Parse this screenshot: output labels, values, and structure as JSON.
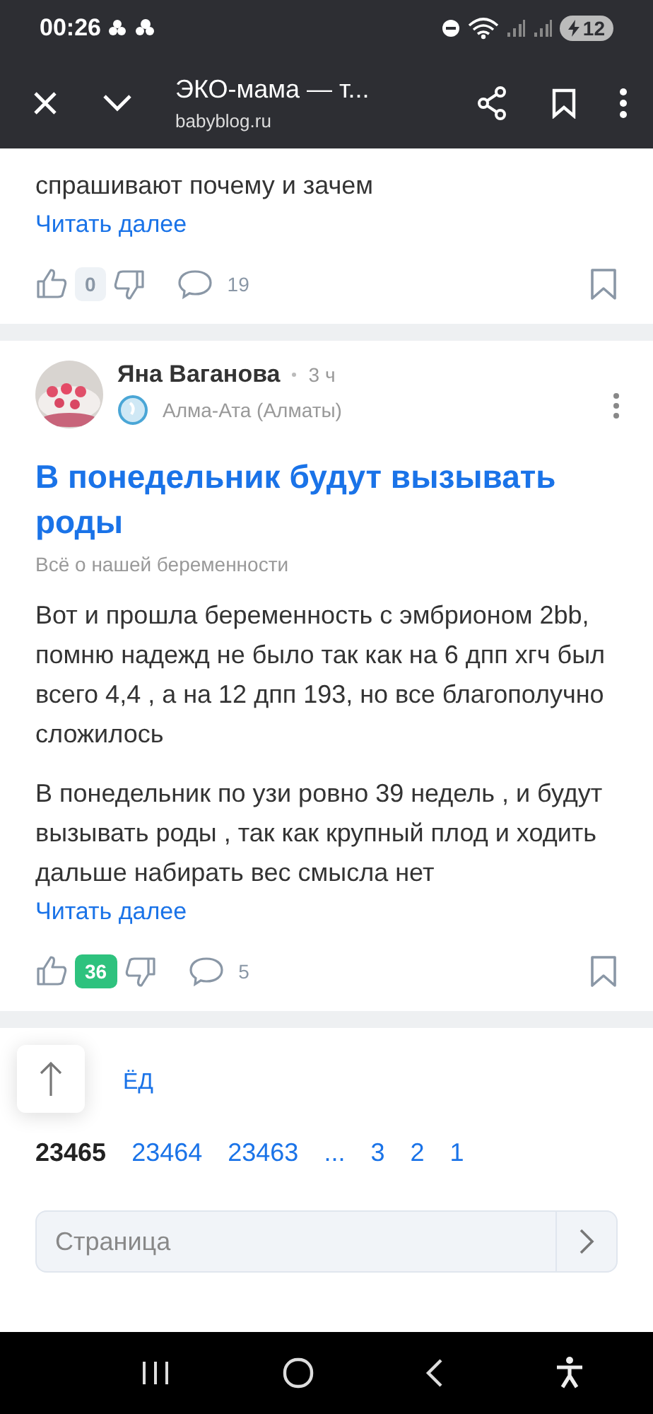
{
  "status_bar": {
    "time": "00:26",
    "battery": "12"
  },
  "browser_bar": {
    "title": "ЭКО-мама — т...",
    "url": "babyblog.ru"
  },
  "posts": [
    {
      "paragraphs": [
        "спрашивают почему и зачем"
      ],
      "read_more": "Читать далее",
      "likes": "0",
      "likes_positive": false,
      "comments": "19"
    },
    {
      "author": "Яна Ваганова",
      "time": "3 ч",
      "location": "Алма-Ата (Алматы)",
      "title": "В понедельник будут вызывать роды",
      "category": "Всё о нашей беременности",
      "paragraphs": [
        "Вот и прошла беременность с эмбрионом 2bb, помню надежд не было так как на 6 дпп хгч был всего 4,4 , а на 12 дпп 193, но все благополучно сложилось",
        "В понедельник по узи ровно 39 недель , и будут вызывать роды , так как крупный плод и ходить дальше набирать вес смысла нет"
      ],
      "read_more": "Читать далее",
      "likes": "36",
      "likes_positive": true,
      "comments": "5"
    }
  ],
  "pager": {
    "next": "ЁД",
    "pages": [
      {
        "label": "23465",
        "selected": true
      },
      {
        "label": "23464",
        "selected": false
      },
      {
        "label": "23463",
        "selected": false
      },
      {
        "label": "...",
        "selected": false
      },
      {
        "label": "3",
        "selected": false
      },
      {
        "label": "2",
        "selected": false
      },
      {
        "label": "1",
        "selected": false
      }
    ],
    "page_field": {
      "placeholder": "Страница"
    }
  }
}
